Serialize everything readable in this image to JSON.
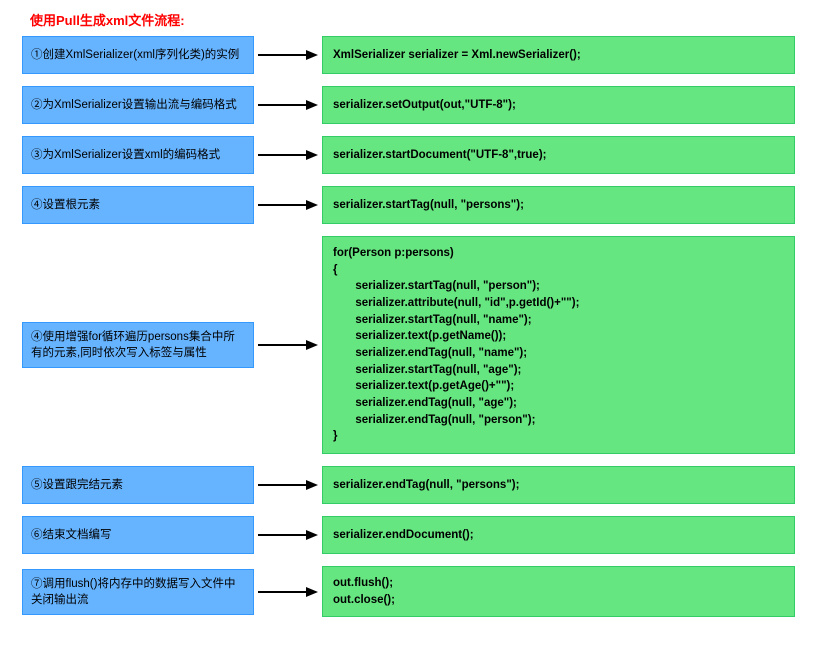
{
  "title": "使用Pull生成xml文件流程:",
  "steps": [
    {
      "label": "①创建XmlSerializer(xml序列化类)的实例",
      "code": "XmlSerializer serializer = Xml.newSerializer();"
    },
    {
      "label": "②为XmlSerializer设置输出流与编码格式",
      "code": "serializer.setOutput(out,\"UTF-8\");"
    },
    {
      "label": "③为XmlSerializer设置xml的编码格式",
      "code": "serializer.startDocument(\"UTF-8\",true);"
    },
    {
      "label": "④设置根元素",
      "code": "serializer.startTag(null, \"persons\");"
    },
    {
      "label": "④使用增强for循环遍历persons集合中所有的元素,同时依次写入标签与属性",
      "code": "for(Person p:persons)\n{\n       serializer.startTag(null, \"person\");\n       serializer.attribute(null, \"id\",p.getId()+\"\");\n       serializer.startTag(null, \"name\");\n       serializer.text(p.getName());\n       serializer.endTag(null, \"name\");\n       serializer.startTag(null, \"age\");\n       serializer.text(p.getAge()+\"\");\n       serializer.endTag(null, \"age\");\n       serializer.endTag(null, \"person\");\n}",
      "multi": true
    },
    {
      "label": "⑤设置跟完结元素",
      "code": "serializer.endTag(null, \"persons\");"
    },
    {
      "label": "⑥结束文档编写",
      "code": "serializer.endDocument();"
    },
    {
      "label": "⑦调用flush()将内存中的数据写入文件中关闭输出流",
      "code": "out.flush();\nout.close();",
      "multi": true
    }
  ]
}
